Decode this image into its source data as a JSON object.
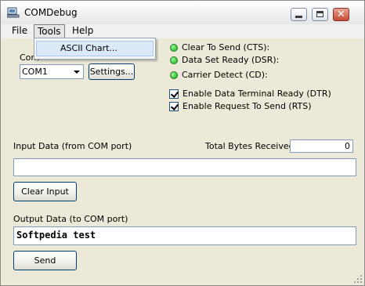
{
  "window": {
    "title": "COMDebug"
  },
  "menu": {
    "file": "File",
    "tools": "Tools",
    "help": "Help"
  },
  "tools_menu": {
    "items": [
      "ASCII Chart..."
    ]
  },
  "port": {
    "label_partial": "Com",
    "selected": "COM1",
    "settings_button": "Settings..."
  },
  "status": {
    "lights": [
      "Clear To Send (CTS):",
      "Data Set Ready (DSR):",
      "Carrier Detect (CD):"
    ],
    "light_color": "#2fc52f"
  },
  "options": {
    "dtr": {
      "label": "Enable Data Terminal Ready (DTR)",
      "checked": true
    },
    "rts": {
      "label": "Enable Request To Send (RTS)",
      "checked": true
    }
  },
  "input": {
    "label": "Input Data (from COM port)",
    "total_label": "Total Bytes Received:",
    "total_value": "0",
    "value": "",
    "clear_button": "Clear Input"
  },
  "output": {
    "label": "Output Data (to COM port)",
    "value": "Softpedia test",
    "send_button": "Send"
  }
}
